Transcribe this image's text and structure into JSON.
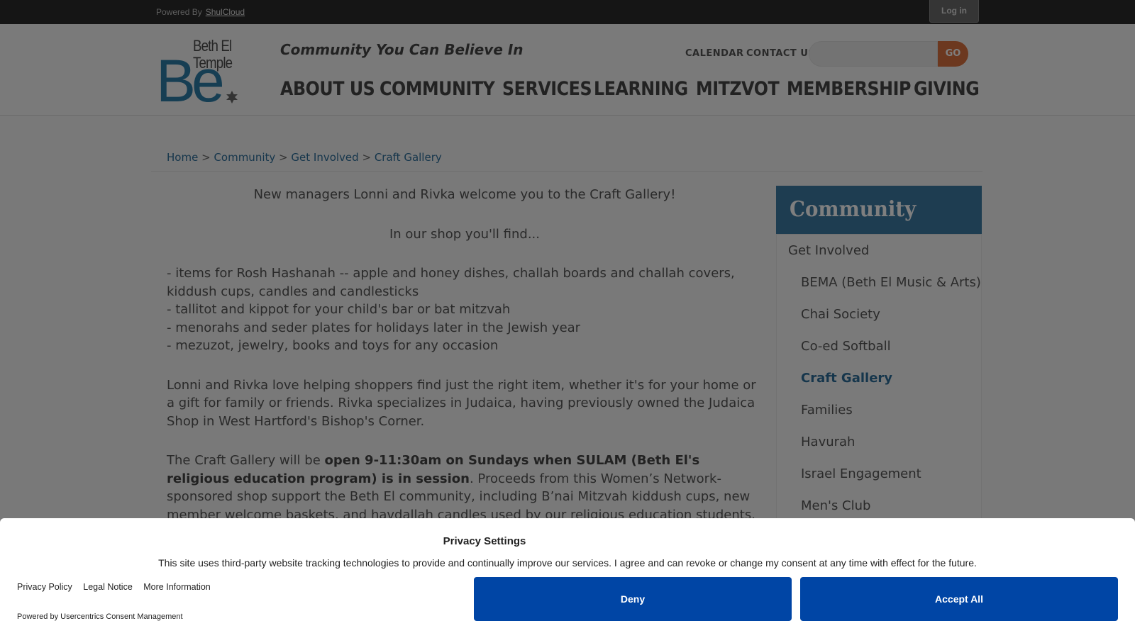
{
  "topbar": {
    "powered_by": "Powered By",
    "powered_by_link": "ShulCloud",
    "login_label": "Log in"
  },
  "header": {
    "logo": {
      "line1": "Beth El",
      "line2": "Temple",
      "mark": "Be"
    },
    "tagline": "Community You Can Believe In",
    "utility_links": [
      "CALENDAR",
      "CONTACT US"
    ],
    "search_placeholder": "",
    "search_button": "GO",
    "nav": [
      "ABOUT US",
      "COMMUNITY",
      "SERVICES",
      "LEARNING",
      "MITZVOT",
      "MEMBERSHIP",
      "GIVING"
    ]
  },
  "breadcrumb": {
    "items": [
      "Home",
      "Community",
      "Get Involved",
      "Craft Gallery"
    ],
    "separator": ">"
  },
  "content": {
    "intro": "New managers Lonni and Rivka welcome you to the Craft Gallery!",
    "find_heading": "In our shop you'll find...",
    "list": [
      "- items for Rosh Hashanah -- apple and honey dishes, challah boards and challah covers, kiddush cups, candles and candlesticks",
      "- tallitot and kippot for your child's bar or bat mitzvah",
      "- menorahs and seder plates for holidays later in the Jewish year",
      "- mezuzot, jewelry, books and toys for any occasion"
    ],
    "para2": "Lonni and Rivka love helping shoppers find just the right item, whether it's for your home or a gift for family or friends. Rivka specializes in Judaica, having previously owned the Judaica Shop in West Hartford's Bishop's Corner.",
    "para3_start": "The Craft Gallery will be ",
    "para3_bold": "open 9-11:30am on Sundays when SULAM (Beth El's religious education program) is in session",
    "para3_end": ". Proceeds from this Women’s Network-sponsored shop support the Beth El community, including B’nai Mitzvah kiddush cups, new member welcome baskets, and havdallah candles used by our religious education students."
  },
  "sidebar": {
    "title": "Community",
    "parent": "Get Involved",
    "items": [
      "BEMA (Beth El Music & Arts)",
      "Chai Society",
      "Co-ed Softball",
      "Craft Gallery",
      "Families",
      "Havurah",
      "Israel Engagement",
      "Men's Club"
    ],
    "active": "Craft Gallery"
  },
  "consent": {
    "title": "Privacy Settings",
    "description": "This site uses third-party website tracking technologies to provide and continually improve our services. I agree and can revoke or change my consent at any time with effect for the future.",
    "links": [
      "Privacy Policy",
      "Legal Notice",
      "More Information"
    ],
    "powered_by": "Powered by Usercentrics Consent Management",
    "deny_label": "Deny",
    "accept_label": "Accept All"
  },
  "colors": {
    "accent_blue": "#3d7aa3",
    "go_orange": "#d9713e",
    "consent_button": "#0045a5"
  }
}
